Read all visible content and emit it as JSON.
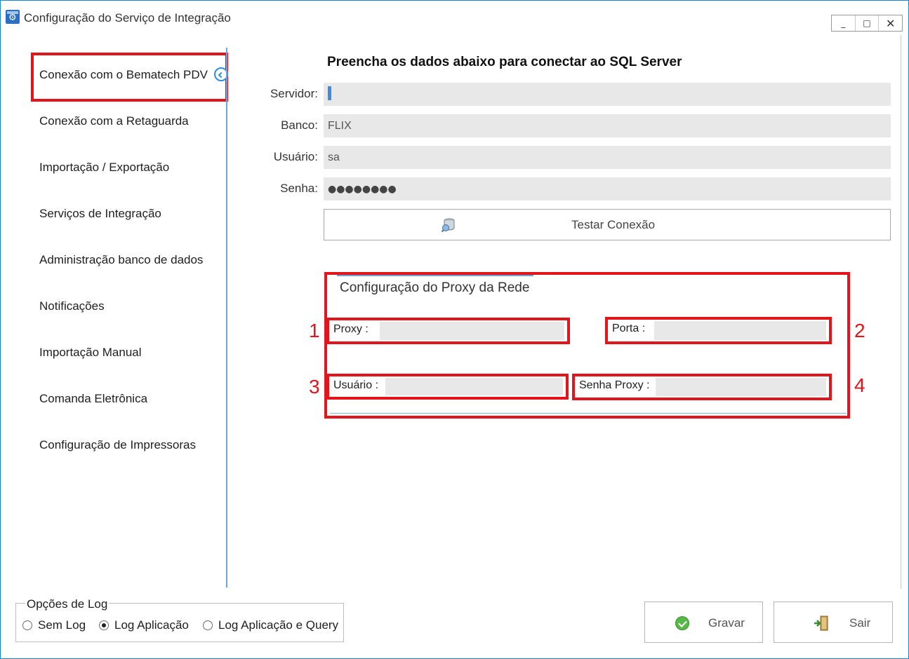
{
  "window": {
    "title": "Configuração do Serviço de Integração",
    "controls": {
      "minimize": "_",
      "maximize": "□",
      "close": "✕"
    }
  },
  "sidebar": {
    "items": [
      {
        "label": "Conexão com o Bematech PDV",
        "active": true
      },
      {
        "label": "Conexão com a Retaguarda"
      },
      {
        "label": "Importação / Exportação"
      },
      {
        "label": "Serviços de Integração"
      },
      {
        "label": "Administração banco de dados"
      },
      {
        "label": "Notificações"
      },
      {
        "label": "Importação Manual"
      },
      {
        "label": "Comanda Eletrônica"
      },
      {
        "label": "Configuração de Impressoras"
      }
    ]
  },
  "sql": {
    "heading": "Preencha os dados abaixo para conectar ao SQL Server",
    "fields": {
      "servidor": {
        "label": "Servidor:",
        "value": ""
      },
      "banco": {
        "label": "Banco:",
        "value": "FLIX"
      },
      "usuario": {
        "label": "Usuário:",
        "value": "sa"
      },
      "senha": {
        "label": "Senha:",
        "value": "●●●●●●●●"
      }
    },
    "test_button": "Testar Conexão"
  },
  "proxy": {
    "title": "Configuração do Proxy da Rede",
    "fields": {
      "proxy": {
        "label": "Proxy :",
        "value": "",
        "marker": "1"
      },
      "porta": {
        "label": "Porta :",
        "value": "",
        "marker": "2"
      },
      "usuario": {
        "label": "Usuário :",
        "value": "",
        "marker": "3"
      },
      "senha_proxy": {
        "label": "Senha Proxy :",
        "value": "",
        "marker": "4"
      }
    }
  },
  "log": {
    "legend": "Opções de Log",
    "options": [
      {
        "label": "Sem Log",
        "checked": false
      },
      {
        "label": "Log Aplicação",
        "checked": true
      },
      {
        "label": "Log Aplicação e Query",
        "checked": false
      }
    ]
  },
  "buttons": {
    "save": "Gravar",
    "exit": "Sair"
  },
  "colors": {
    "highlight": "#e2141c",
    "accent": "#2d8de0",
    "input_bg": "#e8e8e8"
  }
}
